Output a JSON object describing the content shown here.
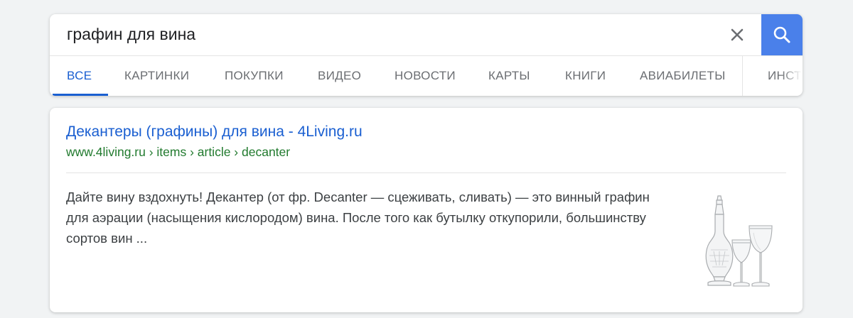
{
  "search": {
    "query": "графин для вина",
    "clear_icon": "close-icon",
    "submit_icon": "search-icon",
    "accent_color": "#4a80ea"
  },
  "tabs": [
    {
      "label": "ВСЕ",
      "active": true
    },
    {
      "label": "КАРТИНКИ"
    },
    {
      "label": "ПОКУПКИ"
    },
    {
      "label": "ВИДЕО"
    },
    {
      "label": "НОВОСТИ"
    },
    {
      "label": "КАРТЫ"
    },
    {
      "label": "КНИГИ"
    },
    {
      "label": "АВИАБИЛЕТЫ"
    },
    {
      "label": "ИНСТ"
    }
  ],
  "result": {
    "title": "Декантеры (графины) для вина - 4Living.ru",
    "url": "www.4living.ru › items › article › decanter",
    "snippet": "Дайте вину вздохнуть! Декантер (от фр. Decanter — сцеживать, сливать) — это винный графин для аэрации (насыщения кислородом) вина. После того как бутылку откупорили, большинству сортов вин ...",
    "thumbnail_icon": "decanter-and-glasses-image",
    "title_color": "#1a5fd1",
    "url_color": "#217a2e"
  }
}
